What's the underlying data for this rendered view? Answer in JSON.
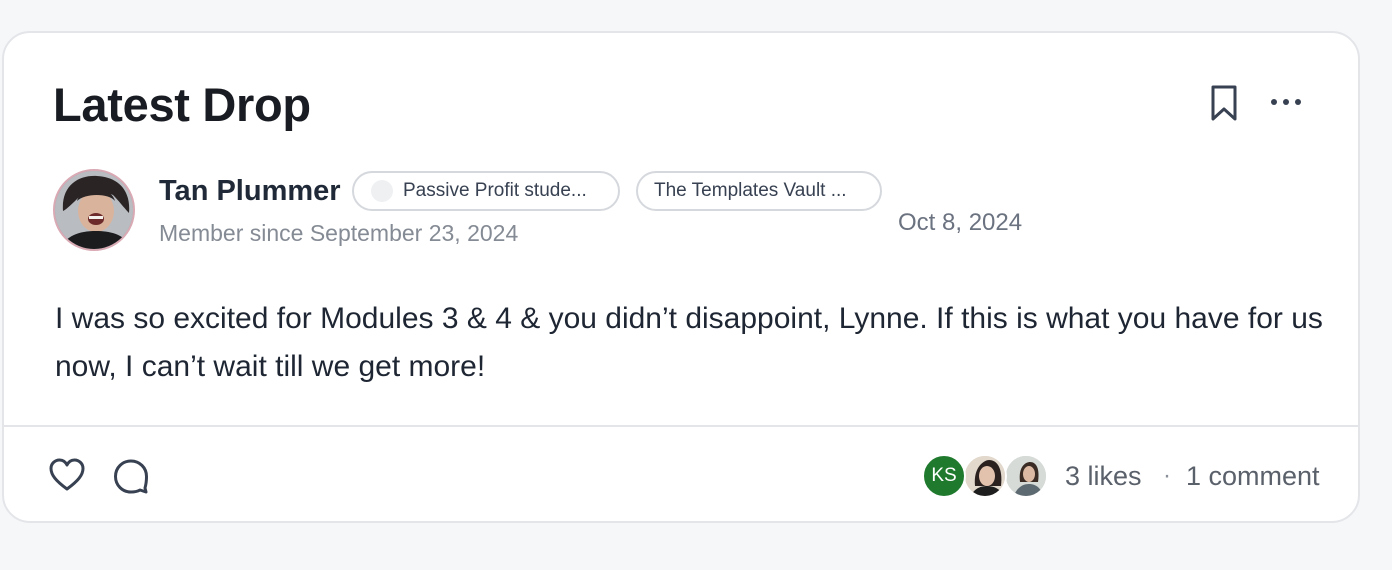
{
  "post": {
    "title": "Latest Drop",
    "author_name": "Tan Plummer",
    "badges": [
      "Passive Profit stude...",
      "The Templates Vault ..."
    ],
    "date": "Oct 8, 2024",
    "member_since": "Member since September 23, 2024",
    "body": "I was so excited for Modules 3 & 4 & you didn’t disappoint, Lynne. If this is what you have for us now, I can’t wait till we get more!"
  },
  "footer": {
    "liker_initials": "KS",
    "likes_label": "3 likes",
    "separator": "·",
    "comments_label": "1 comment"
  },
  "colors": {
    "liker_avatar_bg": "#1f7a2e",
    "avatar_border": "#d9a9b4"
  },
  "icons": [
    "bookmark-icon",
    "more-icon",
    "heart-icon",
    "comment-icon"
  ]
}
